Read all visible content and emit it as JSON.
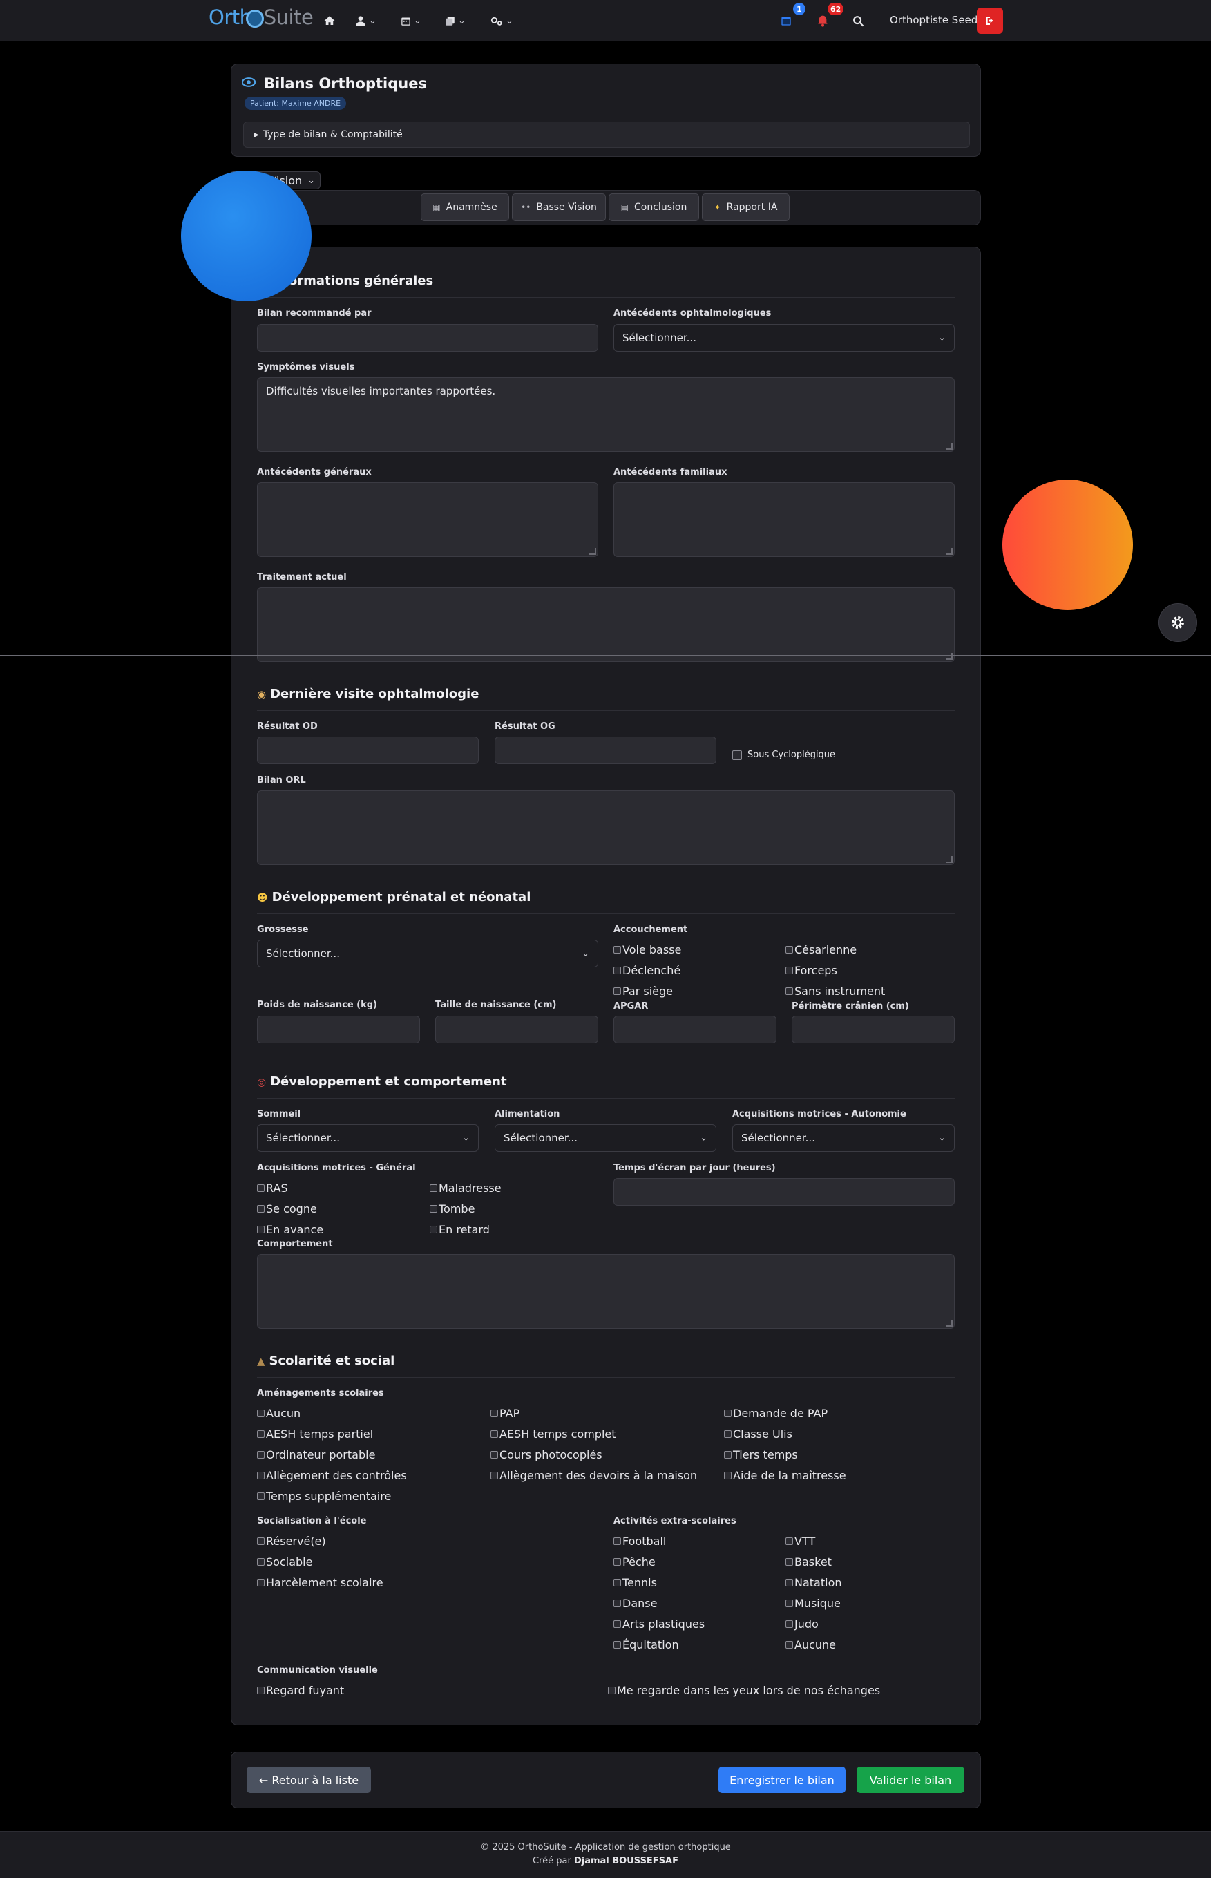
{
  "nav": {
    "logo_ortho": "Orth",
    "logo_o": "o",
    "logo_suite": "Suite",
    "calendar_badge": "1",
    "bell_badge": "62",
    "user_name": "Orthoptiste Seed"
  },
  "header": {
    "title": "Bilans Orthoptiques",
    "patient_pill": "Patient: Maxime ANDRÉ",
    "collapse_label": "Type de bilan & Comptabilité"
  },
  "bilan_type_select": "Basse Vision",
  "tabs": [
    "Anamnèse",
    "Basse Vision",
    "Conclusion",
    "Rapport IA"
  ],
  "info": {
    "title": "Informations générales",
    "bilan_recommande_label": "Bilan recommandé par",
    "antecedents_ophtalmo_label": "Antécédents ophtalmologiques",
    "antecedents_ophtalmo_value": "Sélectionner...",
    "symptomes_label": "Symptômes visuels",
    "symptomes_value": "Difficultés visuelles importantes rapportées.",
    "antecedents_generaux_label": "Antécédents généraux",
    "antecedents_familiaux_label": "Antécédents familiaux",
    "traitement_label": "Traitement actuel"
  },
  "visite": {
    "title": "Dernière visite ophtalmologie",
    "od_label": "Résultat OD",
    "og_label": "Résultat OG",
    "cyclo_label": "Sous Cycloplégique",
    "orl_label": "Bilan ORL"
  },
  "prenatal": {
    "title": "Développement prénatal et néonatal",
    "grossesse_label": "Grossesse",
    "grossesse_value": "Sélectionner...",
    "accouchement_label": "Accouchement",
    "accouchement_options": [
      "Voie basse",
      "Césarienne",
      "Déclenché",
      "Forceps",
      "Par siège",
      "Sans instrument"
    ],
    "poids_label": "Poids de naissance (kg)",
    "taille_label": "Taille de naissance (cm)",
    "apgar_label": "APGAR",
    "perimetre_label": "Périmètre crânien (cm)"
  },
  "comportement": {
    "title": "Développement et comportement",
    "sommeil_label": "Sommeil",
    "sommeil_value": "Sélectionner...",
    "alimentation_label": "Alimentation",
    "alimentation_value": "Sélectionner...",
    "autonomie_label": "Acquisitions motrices - Autonomie",
    "autonomie_value": "Sélectionner...",
    "general_label": "Acquisitions motrices - Général",
    "general_options": [
      "RAS",
      "Maladresse",
      "Se cogne",
      "Tombe",
      "En avance",
      "En retard"
    ],
    "ecran_label": "Temps d'écran par jour (heures)",
    "comportement_label": "Comportement"
  },
  "scolarite": {
    "title": "Scolarité et social",
    "amenagements_label": "Aménagements scolaires",
    "amenagements": [
      "Aucun",
      "PAP",
      "Demande de PAP",
      "AESH temps partiel",
      "AESH temps complet",
      "Classe Ulis",
      "Ordinateur portable",
      "Cours photocopiés",
      "Tiers temps",
      "Allègement des contrôles",
      "Allègement des devoirs à la maison",
      "Aide de la maîtresse",
      "Temps supplémentaire"
    ],
    "socialisation_label": "Socialisation à l'école",
    "socialisation": [
      "Réservé(e)",
      "Sociable",
      "Harcèlement scolaire"
    ],
    "activites_label": "Activités extra-scolaires",
    "activites": [
      "Football",
      "VTT",
      "Pêche",
      "Basket",
      "Tennis",
      "Natation",
      "Danse",
      "Musique",
      "Arts plastiques",
      "Judo",
      "Équitation",
      "Aucune"
    ],
    "communication_label": "Communication visuelle",
    "communication": [
      "Regard fuyant",
      "Me regarde dans les yeux lors de nos échanges"
    ]
  },
  "actions": {
    "back": "← Retour à la liste",
    "save": "Enregistrer le bilan",
    "validate": "Valider le bilan"
  },
  "footer": {
    "line1": "© 2025 OrthoSuite - Application de gestion orthoptique",
    "line2_prefix": "Créé par",
    "line2_author": "Djamal BOUSSEFSAF"
  },
  "colors": {
    "primary": "#2f7cf6",
    "success": "#16a34a",
    "danger": "#e02424",
    "card_bg": "#1c1c21"
  }
}
